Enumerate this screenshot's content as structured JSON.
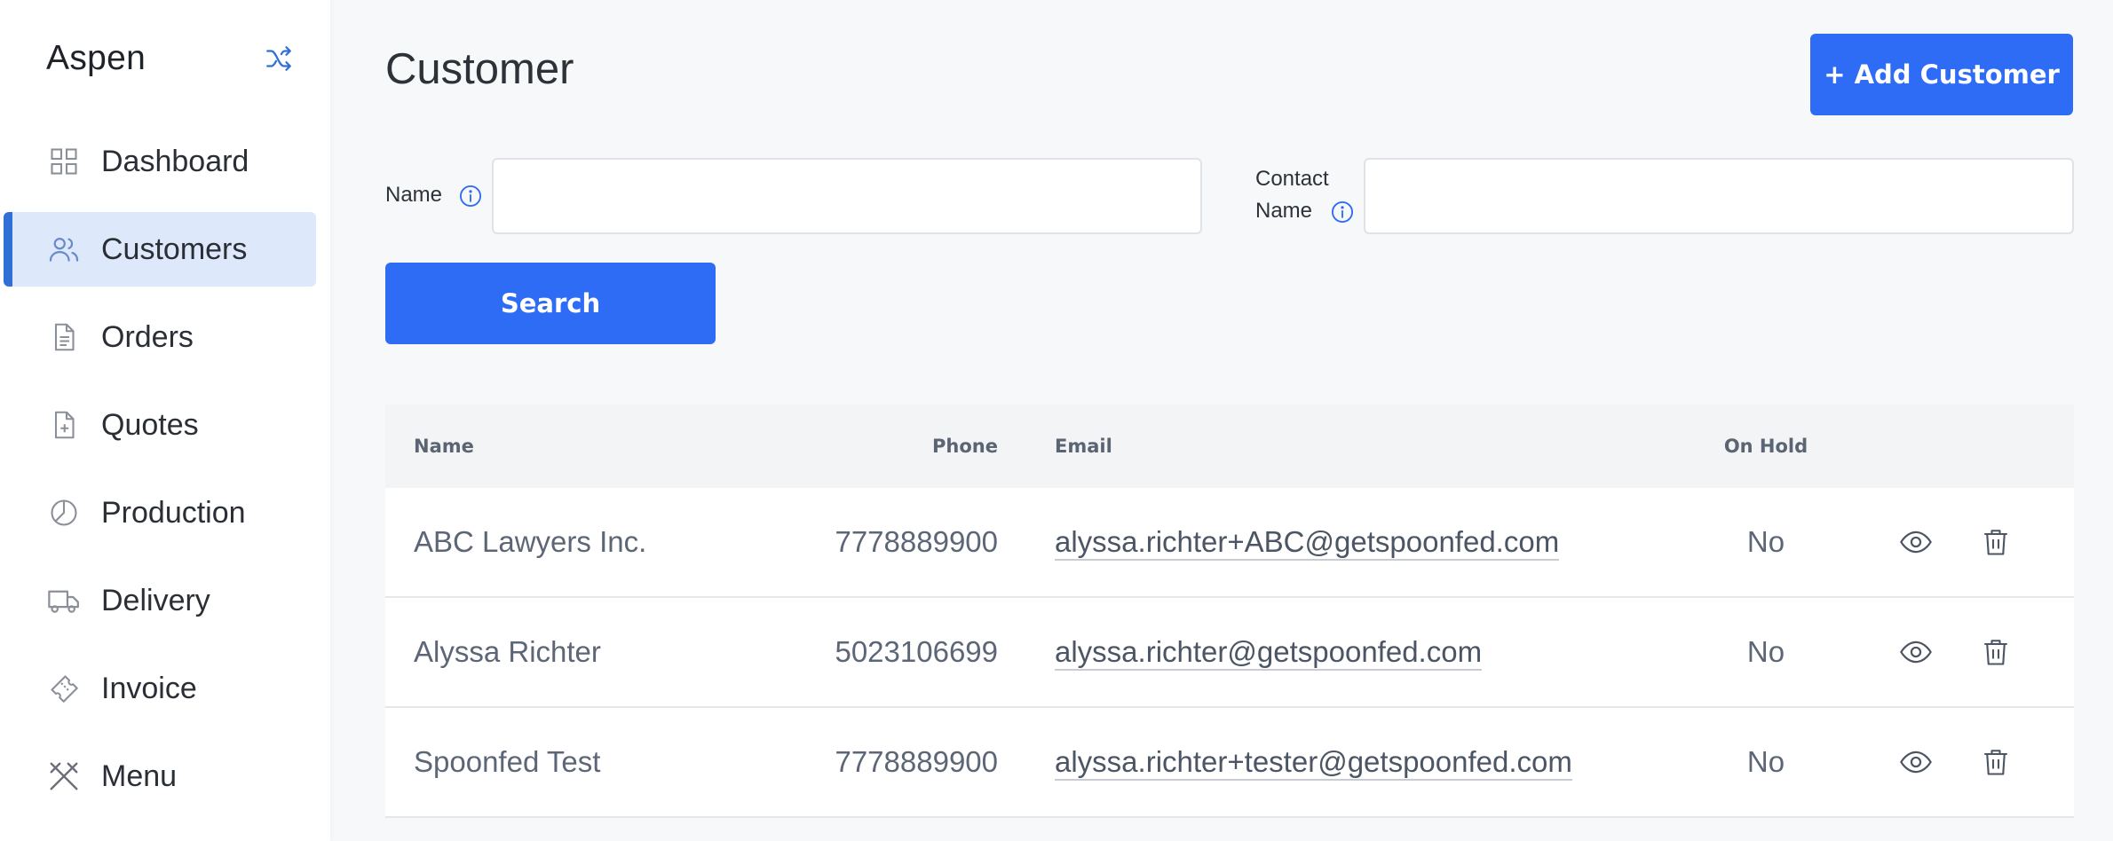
{
  "sidebar": {
    "brand": "Aspen",
    "items": [
      {
        "label": "Dashboard",
        "icon": "dashboard-grid-icon",
        "active": false
      },
      {
        "label": "Customers",
        "icon": "users-icon",
        "active": true
      },
      {
        "label": "Orders",
        "icon": "document-icon",
        "active": false
      },
      {
        "label": "Quotes",
        "icon": "file-plus-icon",
        "active": false
      },
      {
        "label": "Production",
        "icon": "pie-chart-icon",
        "active": false
      },
      {
        "label": "Delivery",
        "icon": "truck-icon",
        "active": false
      },
      {
        "label": "Invoice",
        "icon": "ticket-icon",
        "active": false
      },
      {
        "label": "Menu",
        "icon": "utensils-icon",
        "active": false
      }
    ]
  },
  "page": {
    "title": "Customer",
    "add_button": "+ Add Customer"
  },
  "filters": {
    "name_label": "Name",
    "name_value": "",
    "contact_label_line1": "Contact",
    "contact_label_line2": "Name",
    "contact_value": "",
    "search_button": "Search"
  },
  "table": {
    "headers": {
      "name": "Name",
      "phone": "Phone",
      "email": "Email",
      "on_hold": "On Hold"
    },
    "rows": [
      {
        "name": "ABC Lawyers Inc.",
        "phone": "7778889900",
        "email": "alyssa.richter+ABC@getspoonfed.com",
        "on_hold": "No"
      },
      {
        "name": "Alyssa Richter",
        "phone": "5023106699",
        "email": "alyssa.richter@getspoonfed.com",
        "on_hold": "No"
      },
      {
        "name": "Spoonfed Test",
        "phone": "7778889900",
        "email": "alyssa.richter+tester@getspoonfed.com",
        "on_hold": "No"
      }
    ]
  },
  "colors": {
    "accent": "#2e6cf6",
    "active_bg": "#dde8fb",
    "active_bar": "#2f6fd6"
  }
}
